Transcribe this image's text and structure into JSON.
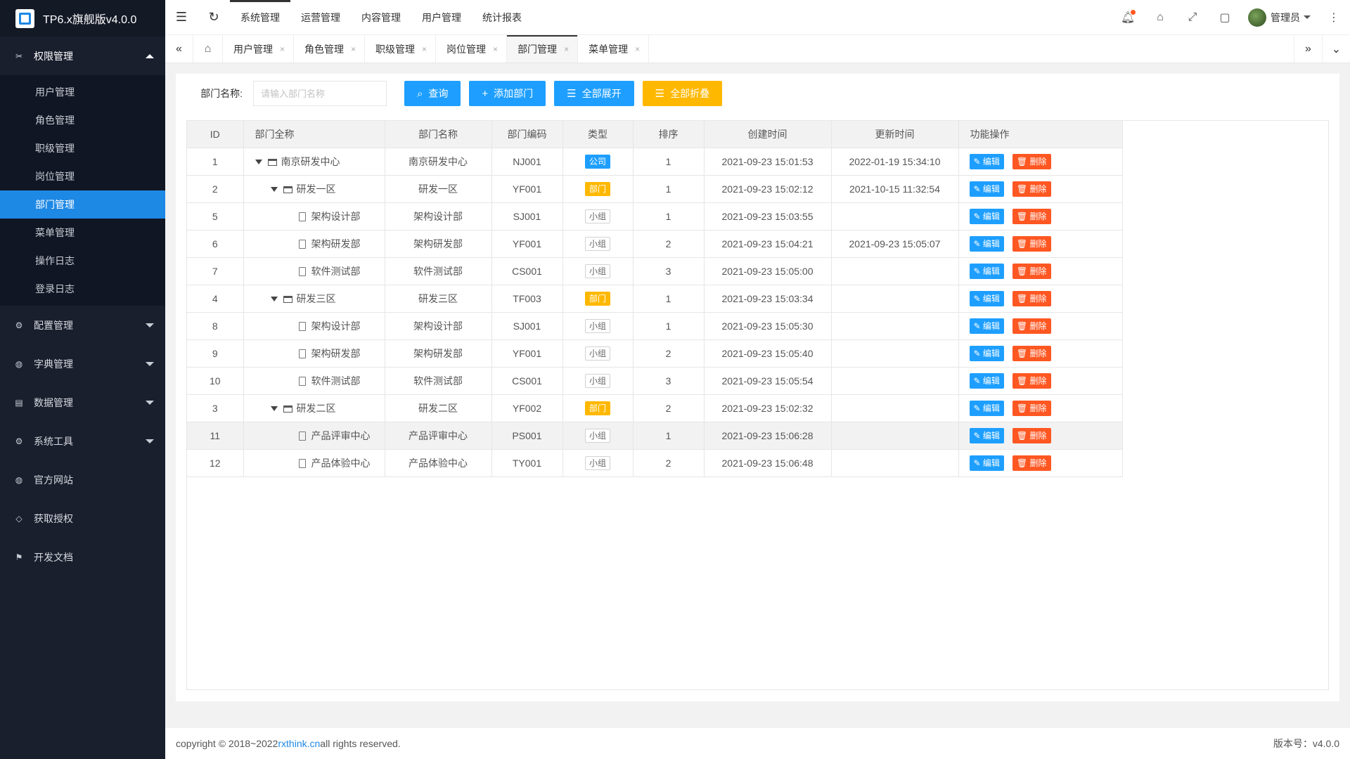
{
  "app": {
    "title": "TP6.x旗舰版v4.0.0"
  },
  "sidebar": {
    "groups": [
      {
        "label": "权限管理",
        "icon": "scissors-icon",
        "open": true,
        "items": [
          "用户管理",
          "角色管理",
          "职级管理",
          "岗位管理",
          "部门管理",
          "菜单管理",
          "操作日志",
          "登录日志"
        ],
        "active": "部门管理"
      },
      {
        "label": "配置管理",
        "icon": "gear-icon"
      },
      {
        "label": "字典管理",
        "icon": "globe-icon"
      },
      {
        "label": "数据管理",
        "icon": "book-icon"
      },
      {
        "label": "系统工具",
        "icon": "gear-icon"
      },
      {
        "label": "官方网站",
        "icon": "globe-icon"
      },
      {
        "label": "获取授权",
        "icon": "diamond-icon"
      },
      {
        "label": "开发文档",
        "icon": "flag-icon"
      }
    ]
  },
  "header": {
    "nav": [
      "系统管理",
      "运营管理",
      "内容管理",
      "用户管理",
      "统计报表"
    ],
    "active_nav": "系统管理",
    "user": "管理员"
  },
  "tabs": {
    "items": [
      "用户管理",
      "角色管理",
      "职级管理",
      "岗位管理",
      "部门管理",
      "菜单管理"
    ],
    "active": "部门管理",
    "close_glyph": "×"
  },
  "search": {
    "label": "部门名称:",
    "placeholder": "请输入部门名称",
    "query": "查询",
    "add": "添加部门",
    "expand": "全部展开",
    "collapse": "全部折叠"
  },
  "table": {
    "columns": [
      "ID",
      "部门全称",
      "部门名称",
      "部门编码",
      "类型",
      "排序",
      "创建时间",
      "更新时间",
      "功能操作"
    ],
    "edit_label": "编辑",
    "delete_label": "删除",
    "rows": [
      {
        "id": "1",
        "level": 0,
        "kind": "folder",
        "full": "南京研发中心",
        "name": "南京研发中心",
        "code": "NJ001",
        "type": "公司",
        "sort": "1",
        "created": "2021-09-23 15:01:53",
        "updated": "2022-01-19 15:34:10"
      },
      {
        "id": "2",
        "level": 1,
        "kind": "folder",
        "full": "研发一区",
        "name": "研发一区",
        "code": "YF001",
        "type": "部门",
        "sort": "1",
        "created": "2021-09-23 15:02:12",
        "updated": "2021-10-15 11:32:54"
      },
      {
        "id": "5",
        "level": 2,
        "kind": "file",
        "full": "架构设计部",
        "name": "架构设计部",
        "code": "SJ001",
        "type": "小组",
        "sort": "1",
        "created": "2021-09-23 15:03:55",
        "updated": ""
      },
      {
        "id": "6",
        "level": 2,
        "kind": "file",
        "full": "架构研发部",
        "name": "架构研发部",
        "code": "YF001",
        "type": "小组",
        "sort": "2",
        "created": "2021-09-23 15:04:21",
        "updated": "2021-09-23 15:05:07"
      },
      {
        "id": "7",
        "level": 2,
        "kind": "file",
        "full": "软件测试部",
        "name": "软件测试部",
        "code": "CS001",
        "type": "小组",
        "sort": "3",
        "created": "2021-09-23 15:05:00",
        "updated": ""
      },
      {
        "id": "4",
        "level": 1,
        "kind": "folder",
        "full": "研发三区",
        "name": "研发三区",
        "code": "TF003",
        "type": "部门",
        "sort": "1",
        "created": "2021-09-23 15:03:34",
        "updated": ""
      },
      {
        "id": "8",
        "level": 2,
        "kind": "file",
        "full": "架构设计部",
        "name": "架构设计部",
        "code": "SJ001",
        "type": "小组",
        "sort": "1",
        "created": "2021-09-23 15:05:30",
        "updated": ""
      },
      {
        "id": "9",
        "level": 2,
        "kind": "file",
        "full": "架构研发部",
        "name": "架构研发部",
        "code": "YF001",
        "type": "小组",
        "sort": "2",
        "created": "2021-09-23 15:05:40",
        "updated": ""
      },
      {
        "id": "10",
        "level": 2,
        "kind": "file",
        "full": "软件测试部",
        "name": "软件测试部",
        "code": "CS001",
        "type": "小组",
        "sort": "3",
        "created": "2021-09-23 15:05:54",
        "updated": ""
      },
      {
        "id": "3",
        "level": 1,
        "kind": "folder",
        "full": "研发二区",
        "name": "研发二区",
        "code": "YF002",
        "type": "部门",
        "sort": "2",
        "created": "2021-09-23 15:02:32",
        "updated": ""
      },
      {
        "id": "11",
        "level": 2,
        "kind": "file",
        "full": "产品评审中心",
        "name": "产品评审中心",
        "code": "PS001",
        "type": "小组",
        "sort": "1",
        "created": "2021-09-23 15:06:28",
        "updated": "",
        "hover": true
      },
      {
        "id": "12",
        "level": 2,
        "kind": "file",
        "full": "产品体验中心",
        "name": "产品体验中心",
        "code": "TY001",
        "type": "小组",
        "sort": "2",
        "created": "2021-09-23 15:06:48",
        "updated": ""
      }
    ]
  },
  "footer": {
    "prefix": "copyright © 2018~2022 ",
    "link": "rxthink.cn",
    "suffix": " all rights reserved.",
    "version": "版本号：v4.0.0"
  },
  "colors": {
    "sidebar_bg": "#1a1f2e",
    "accent": "#1e88e5",
    "btn_blue": "#1e9fff",
    "btn_orange": "#ffb800",
    "danger": "#ff5722"
  }
}
